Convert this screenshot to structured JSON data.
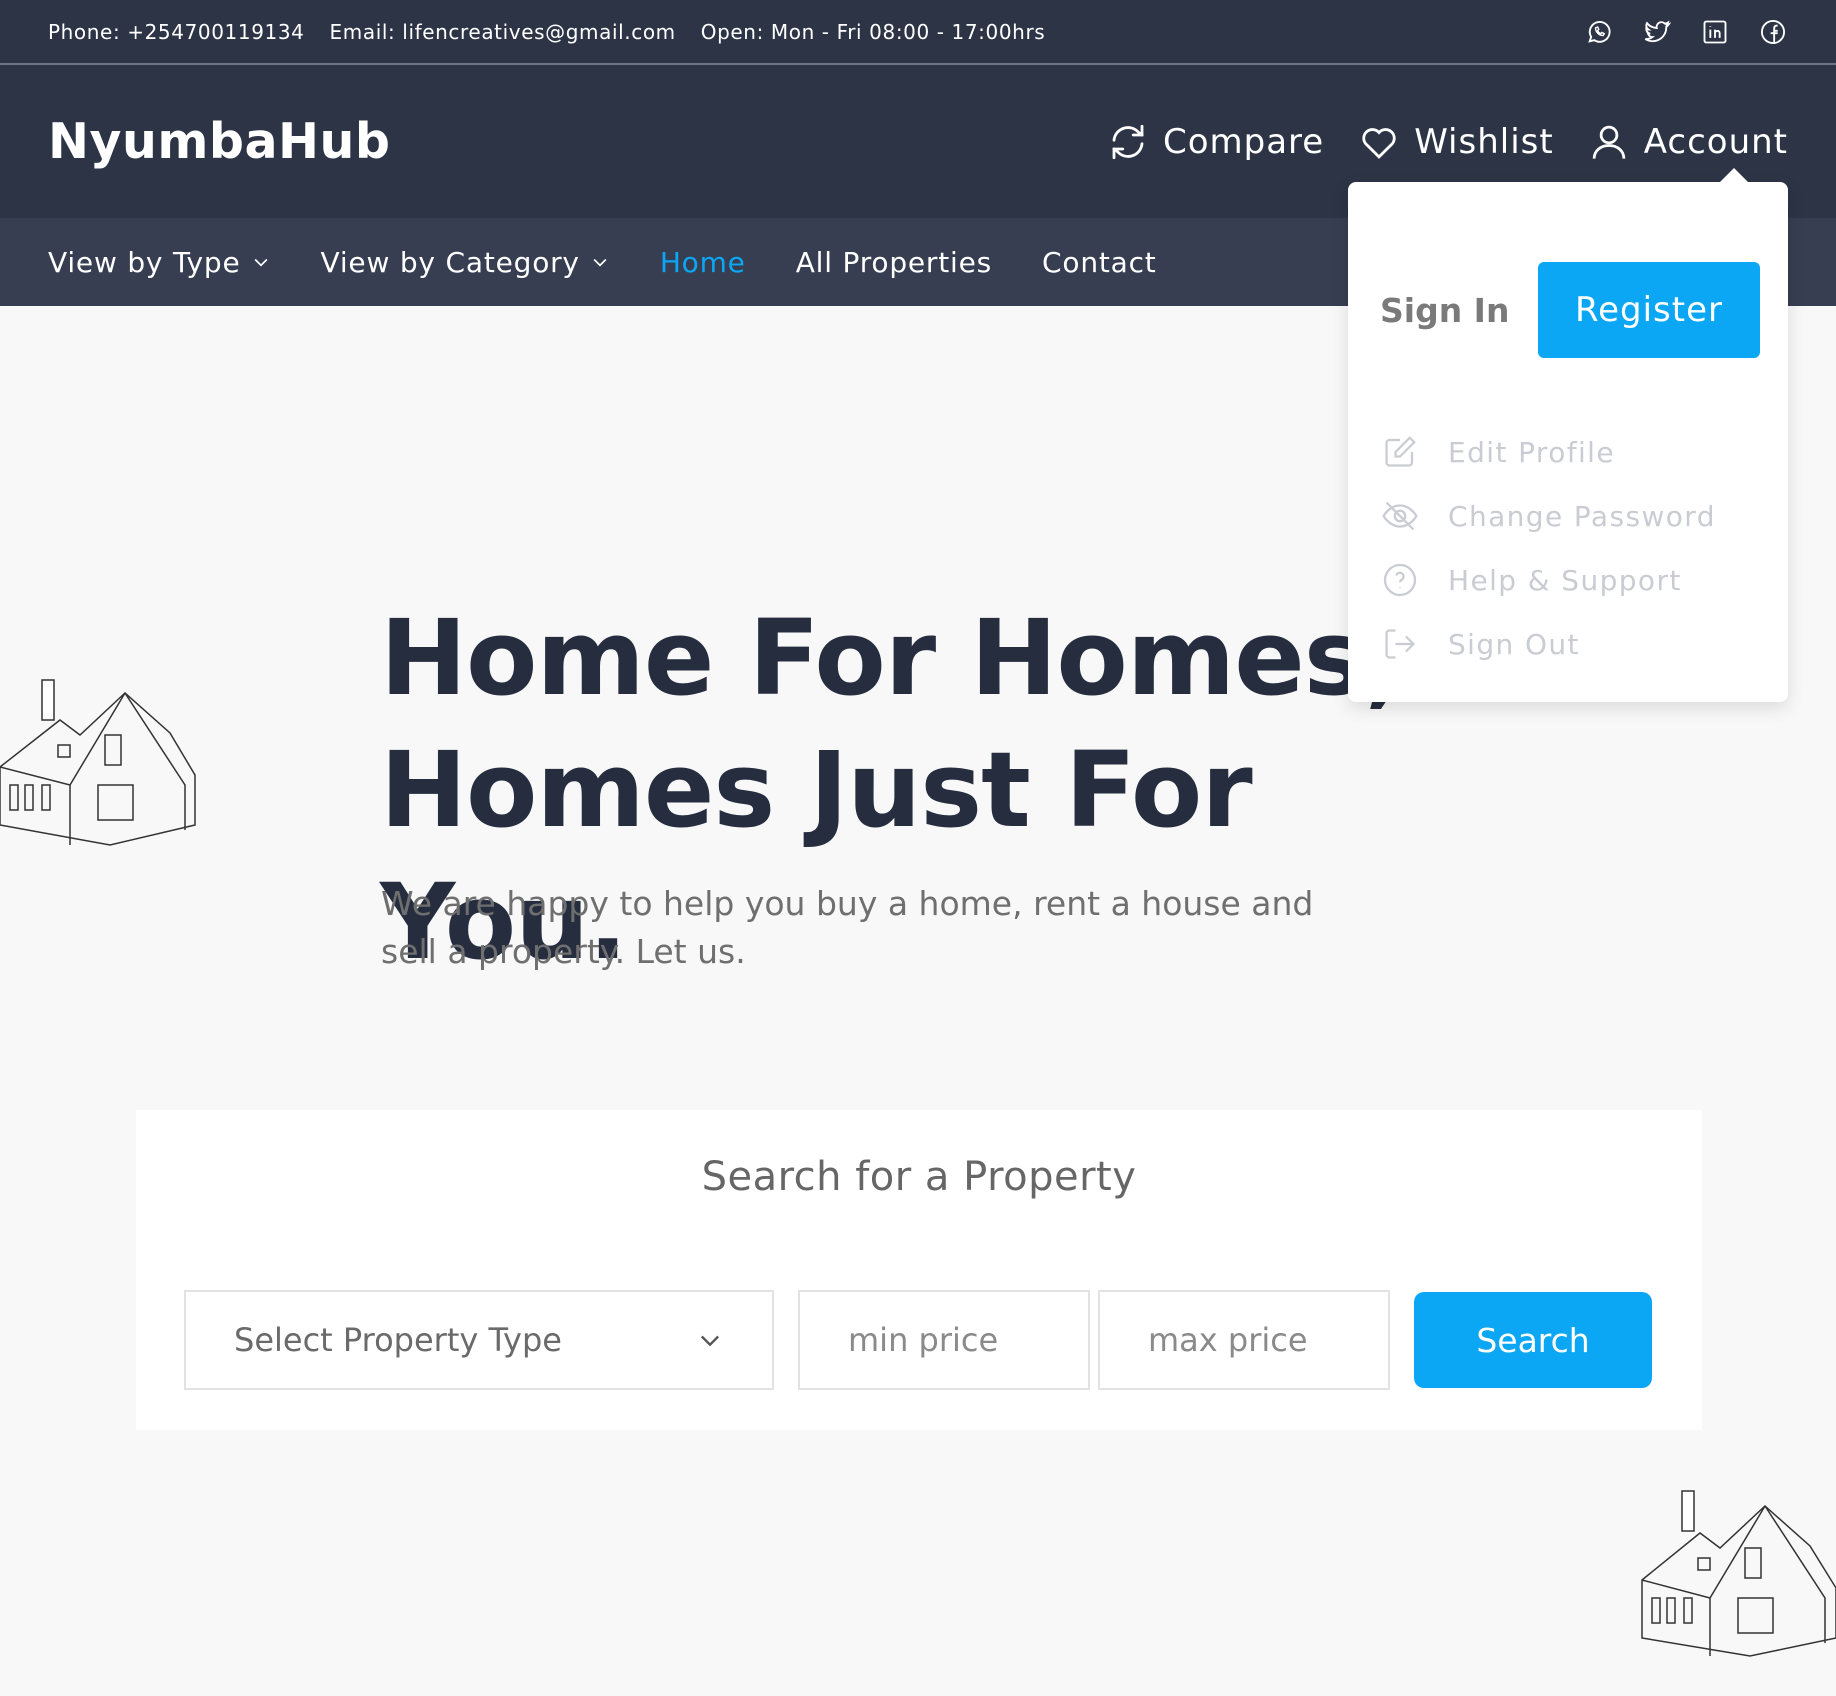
{
  "topbar": {
    "phone": "Phone: +254700119134",
    "email": "Email: lifencreatives@gmail.com",
    "hours": "Open: Mon - Fri 08:00 - 17:00hrs",
    "social": [
      "whatsapp-icon",
      "twitter-icon",
      "linkedin-icon",
      "facebook-icon"
    ]
  },
  "brand": {
    "logo": "NyumbaHub"
  },
  "header_actions": {
    "compare": "Compare",
    "wishlist": "Wishlist",
    "account": "Account"
  },
  "nav": {
    "items": [
      {
        "label": "View by Type",
        "dropdown": true
      },
      {
        "label": "View by Category",
        "dropdown": true
      },
      {
        "label": "Home",
        "active": true
      },
      {
        "label": "All Properties"
      },
      {
        "label": "Contact"
      }
    ]
  },
  "account_menu": {
    "sign_in": "Sign In",
    "register": "Register",
    "items": [
      {
        "label": "Edit Profile",
        "icon": "edit-icon"
      },
      {
        "label": "Change Password",
        "icon": "eye-off-icon"
      },
      {
        "label": "Help & Support",
        "icon": "help-icon"
      },
      {
        "label": "Sign Out",
        "icon": "sign-out-icon"
      }
    ]
  },
  "hero": {
    "title_line1": "Home For Homes,",
    "title_line2": "Homes Just For You.",
    "subtitle": "We are happy to help you buy a home, rent a house and sell a property. Let us."
  },
  "search": {
    "title": "Search for a Property",
    "type_select": "Select Property Type",
    "min_placeholder": "min price",
    "max_placeholder": "max price",
    "button": "Search"
  },
  "colors": {
    "header_bg": "#2c3446",
    "nav_bg": "#373e51",
    "accent": "#0ba7f5",
    "hero_text": "#252d3f"
  }
}
